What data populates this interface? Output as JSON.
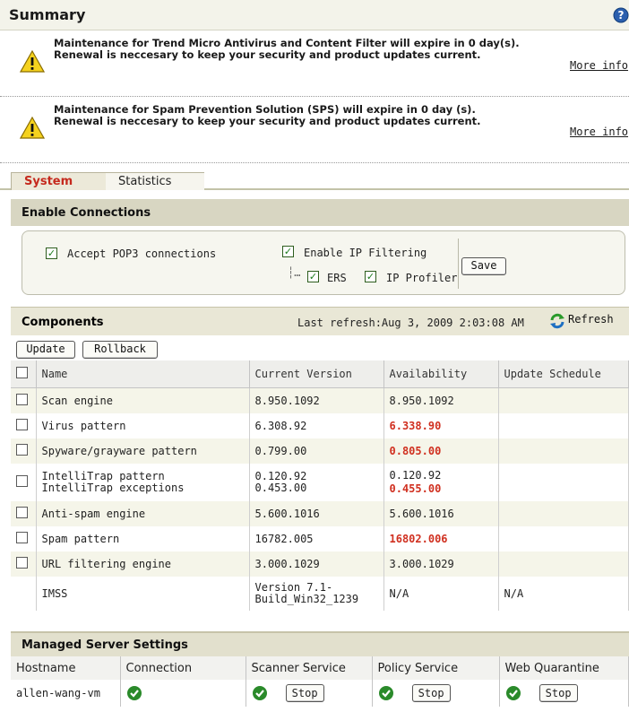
{
  "summary": {
    "title": "Summary",
    "notices": [
      {
        "line1": "Maintenance for Trend Micro Antivirus and Content Filter will expire in 0 day(s).",
        "line2": "Renewal is neccesary to keep your security and product updates current.",
        "link": "More info"
      },
      {
        "line1": "Maintenance for Spam Prevention Solution (SPS) will expire in 0 day (s).",
        "line2": "Renewal is neccesary to keep your security and product updates current.",
        "link": "More info"
      }
    ]
  },
  "tabs": [
    {
      "label": "System",
      "active": true
    },
    {
      "label": "Statistics",
      "active": false
    }
  ],
  "enable_connections": {
    "title": "Enable Connections",
    "accept_pop3": "Accept POP3 connections",
    "enable_ip_filtering": "Enable IP Filtering",
    "ers": "ERS",
    "ip_profiler": "IP Profiler",
    "save": "Save"
  },
  "components": {
    "title": "Components",
    "last_refresh": "Last refresh:Aug 3, 2009 2:03:08 AM",
    "refresh_label": "Refresh",
    "update_label": "Update",
    "rollback_label": "Rollback",
    "headers": [
      "Name",
      "Current Version",
      "Availability",
      "Update Schedule"
    ],
    "rows": [
      {
        "name": "Scan engine",
        "current": "8.950.1092",
        "available": "8.950.1092",
        "newer": false,
        "schedule": ""
      },
      {
        "name": "Virus pattern",
        "current": "6.308.92",
        "available": "6.338.90",
        "newer": true,
        "schedule": ""
      },
      {
        "name": "Spyware/grayware pattern",
        "current": "0.799.00",
        "available": "0.805.00",
        "newer": true,
        "schedule": ""
      },
      {
        "name": "IntelliTrap pattern",
        "name2": "IntelliTrap exceptions",
        "current": "0.120.92",
        "current2": "0.453.00",
        "available": "0.120.92",
        "available2": "0.455.00",
        "newer": false,
        "newer2": true,
        "schedule": ""
      },
      {
        "name": "Anti-spam engine",
        "current": "5.600.1016",
        "available": "5.600.1016",
        "newer": false,
        "schedule": ""
      },
      {
        "name": "Spam pattern",
        "current": "16782.005",
        "available": "16802.006",
        "newer": true,
        "schedule": ""
      },
      {
        "name": "URL filtering engine",
        "current": "3.000.1029",
        "available": "3.000.1029",
        "newer": false,
        "schedule": ""
      },
      {
        "name": "IMSS",
        "current": "Version 7.1-",
        "current2": "Build_Win32_1239",
        "available": "N/A",
        "newer": false,
        "schedule": "N/A"
      }
    ]
  },
  "managed_servers": {
    "title": "Managed Server Settings",
    "headers": [
      "Hostname",
      "Connection",
      "Scanner Service",
      "Policy Service",
      "Web Quarantine"
    ],
    "rows": [
      {
        "hostname": "allen-wang-vm",
        "stop_label": "Stop"
      }
    ]
  },
  "colors": {
    "accent_red": "#d03020",
    "ok_green": "#2a8a2a",
    "warn_yellow": "#f5d21e"
  },
  "icons": {
    "help": "help-icon",
    "warning": "warning-icon",
    "refresh": "refresh-icon",
    "ok": "check-circle-icon"
  }
}
